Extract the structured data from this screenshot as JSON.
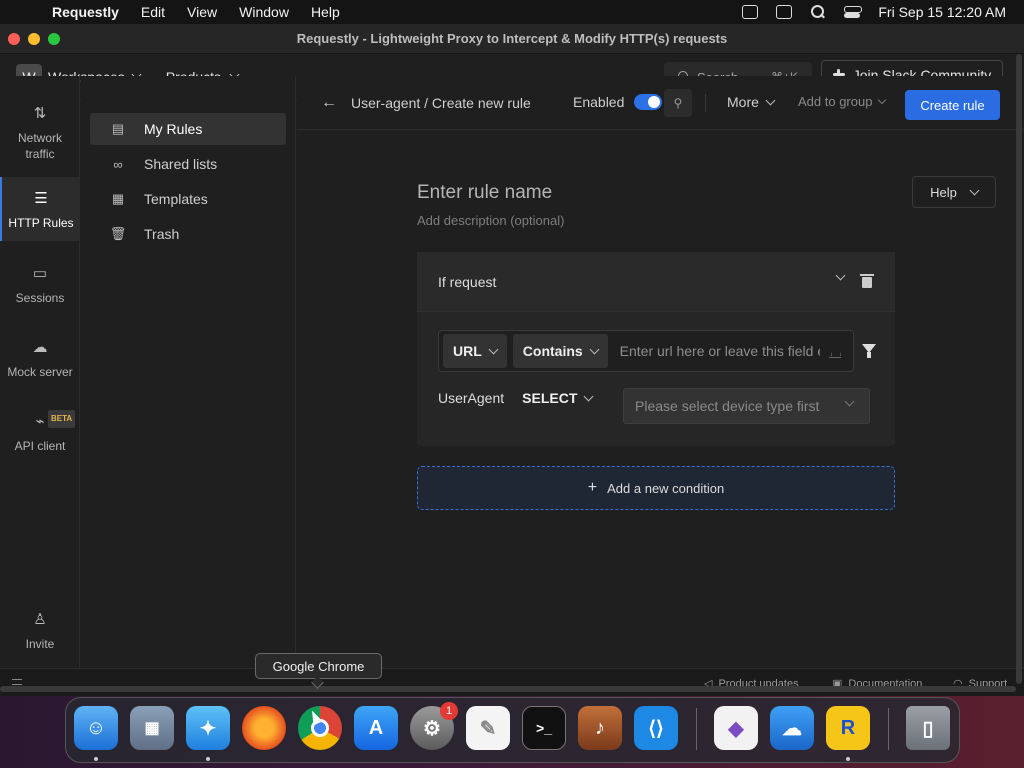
{
  "menubar": {
    "app_name": "Requestly",
    "menus": [
      "Edit",
      "View",
      "Window",
      "Help"
    ],
    "datetime": "Fri Sep 15  12:20 AM"
  },
  "window": {
    "title": "Requestly - Lightweight Proxy to Intercept & Modify HTTP(s) requests"
  },
  "topbar": {
    "workspace_initial": "W",
    "workspace_label": "Workspaces",
    "products_label": "Products",
    "search_label": "Search",
    "search_shortcut": "⌘+K",
    "slack_label": "Join Slack Community"
  },
  "rail": {
    "items": [
      {
        "label_line1": "Network",
        "label_line2": "traffic",
        "icon": "arrows-updown-icon"
      },
      {
        "label_line1": "HTTP Rules",
        "label_line2": "",
        "icon": "sliders-icon"
      },
      {
        "label_line1": "Sessions",
        "label_line2": "",
        "icon": "video-icon"
      },
      {
        "label_line1": "Mock server",
        "label_line2": "",
        "icon": "cloud-icon"
      },
      {
        "label_line1": "API client",
        "label_line2": "",
        "icon": "plug-icon"
      }
    ],
    "beta_badge": "BETA",
    "invite_label": "Invite"
  },
  "sidebar": {
    "items": [
      {
        "label": "My Rules"
      },
      {
        "label": "Shared lists"
      },
      {
        "label": "Templates"
      },
      {
        "label": "Trash"
      }
    ]
  },
  "header": {
    "breadcrumb": "User-agent / Create new rule",
    "enabled_label": "Enabled",
    "more_label": "More",
    "add_to_group_label": "Add to group",
    "create_label": "Create rule"
  },
  "editor": {
    "rule_name_placeholder": "Enter rule name",
    "description_placeholder": "Add description (optional)",
    "help_label": "Help",
    "condition_title": "If request",
    "url_pill": "URL",
    "operator_pill": "Contains",
    "url_placeholder": "Enter url here or leave this field empty",
    "useragent_label": "UserAgent",
    "useragent_select": "SELECT",
    "device_placeholder": "Please select device type first",
    "add_condition_label": "Add a new condition"
  },
  "footer": {
    "product_updates": "Product updates",
    "documentation": "Documentation",
    "support": "Support"
  },
  "tooltip": {
    "text": "Google Chrome"
  },
  "dock": {
    "settings_badge": "1"
  },
  "colors": {
    "accent": "#2a6de3",
    "background": "#1f1f1f"
  }
}
